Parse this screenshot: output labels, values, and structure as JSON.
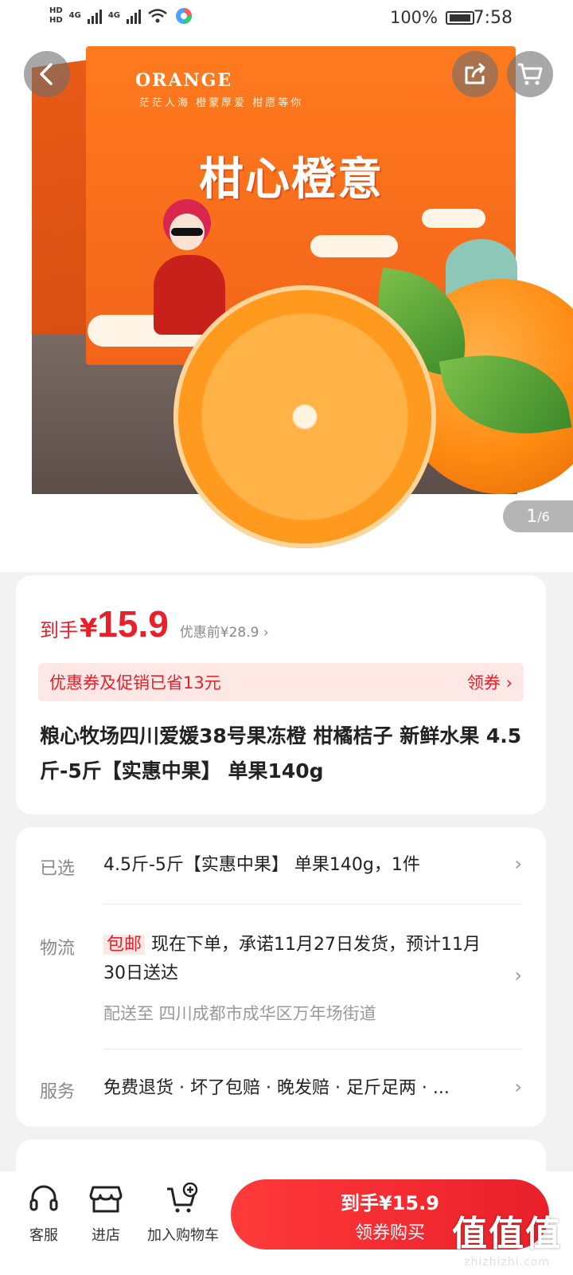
{
  "status_bar": {
    "hd1": "HD",
    "hd2": "HD",
    "net1": "4G",
    "net2": "4G",
    "battery": "100%",
    "time": "7:58"
  },
  "gallery": {
    "box_word": "ORANGE",
    "box_slogan": "茫茫人海 橙蒙厚爱 柑愿等你",
    "box_brand": "柑心橙意",
    "pager_current": "1",
    "pager_total": "/6"
  },
  "price_card": {
    "label": "到手",
    "yen": "¥",
    "price": "15.9",
    "before": "优惠前¥28.9 ›",
    "coupon_text": "优惠券及促销已省13元",
    "coupon_action": "领券 ›",
    "title": "粮心牧场四川爱媛38号果冻橙 柑橘桔子 新鲜水果 4.5斤-5斤【实惠中果】 单果140g"
  },
  "detail_card": {
    "selected_label": "已选",
    "selected_value": "4.5斤-5斤【实惠中果】 单果140g，1件",
    "logistics_label": "物流",
    "free_shipping": "包邮",
    "logistics_value": "现在下单，承诺11月27日发货，预计11月30日送达",
    "delivery_to": "配送至 四川成都市成华区万年场街道",
    "service_label": "服务",
    "service_value": "免费退货 · 坏了包赔 · 晚发赔 · 足斤足两 · ..."
  },
  "bottom_bar": {
    "service": "客服",
    "store": "进店",
    "cart": "加入购物车",
    "buy_price": "到手¥15.9",
    "buy_label": "领券购买"
  },
  "watermark": {
    "big": "值值值",
    "small": "zhizhizhi.com"
  },
  "colors": {
    "accent": "#e8202a",
    "coupon_bg": "#fde8e6"
  }
}
